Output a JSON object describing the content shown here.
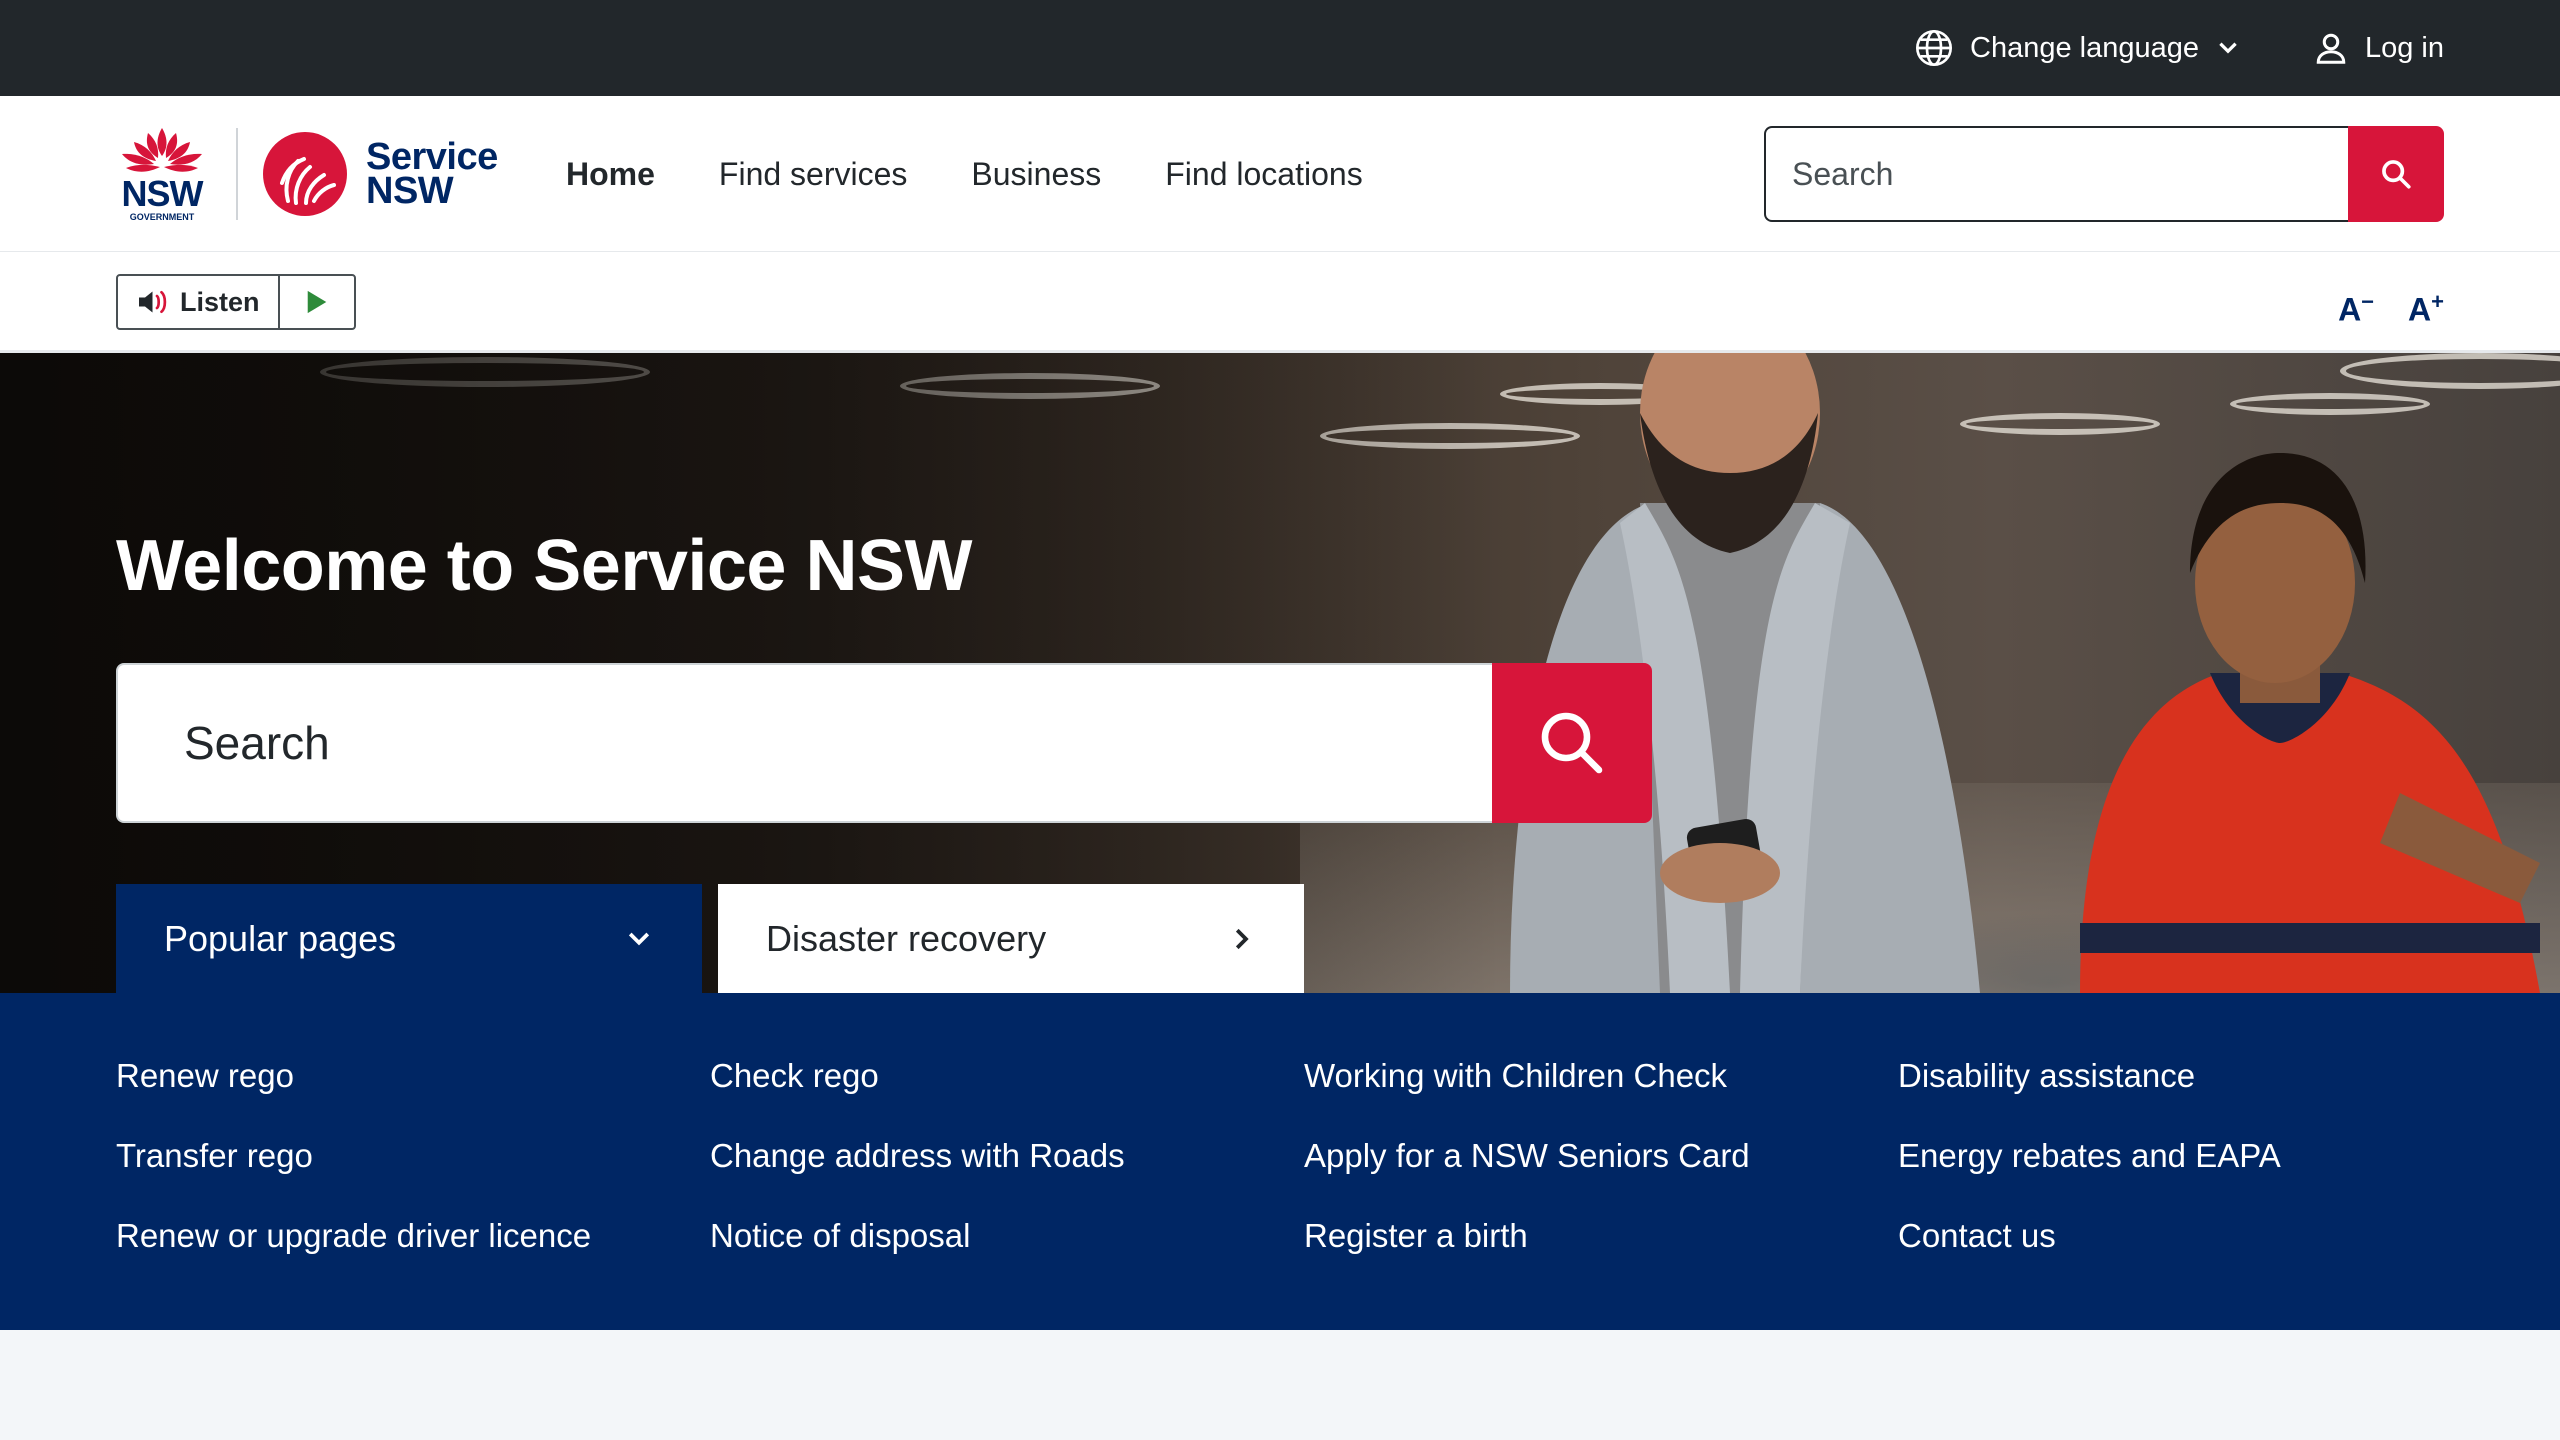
{
  "utility": {
    "change_language": "Change language",
    "login": "Log in"
  },
  "header": {
    "nsw_logo_text": "NSW",
    "nsw_logo_subtext": "GOVERNMENT",
    "brand_line1": "Service",
    "brand_line2": "NSW",
    "nav": [
      {
        "label": "Home",
        "active": true
      },
      {
        "label": "Find services"
      },
      {
        "label": "Business"
      },
      {
        "label": "Find locations"
      }
    ],
    "search_placeholder": "Search"
  },
  "toolbar": {
    "listen_label": "Listen",
    "decrease_text": "A",
    "decrease_sup": "−",
    "increase_text": "A",
    "increase_sup": "+"
  },
  "hero": {
    "title": "Welcome to Service NSW",
    "search_placeholder": "Search",
    "tabs": [
      {
        "label": "Popular pages",
        "icon": "chevron-down-icon"
      },
      {
        "label": "Disaster recovery",
        "icon": "chevron-right-icon"
      }
    ]
  },
  "popular_pages": {
    "columns": [
      [
        "Renew rego",
        "Transfer rego",
        "Renew or upgrade driver licence"
      ],
      [
        "Check rego",
        "Change address with Roads",
        "Notice of disposal"
      ],
      [
        "Working with Children Check",
        "Apply for a NSW Seniors Card",
        "Register a birth"
      ],
      [
        "Disability assistance",
        "Energy rebates and EAPA",
        "Contact us"
      ]
    ]
  },
  "colors": {
    "navy": "#002664",
    "red": "#d7153a",
    "dark": "#22272b"
  }
}
